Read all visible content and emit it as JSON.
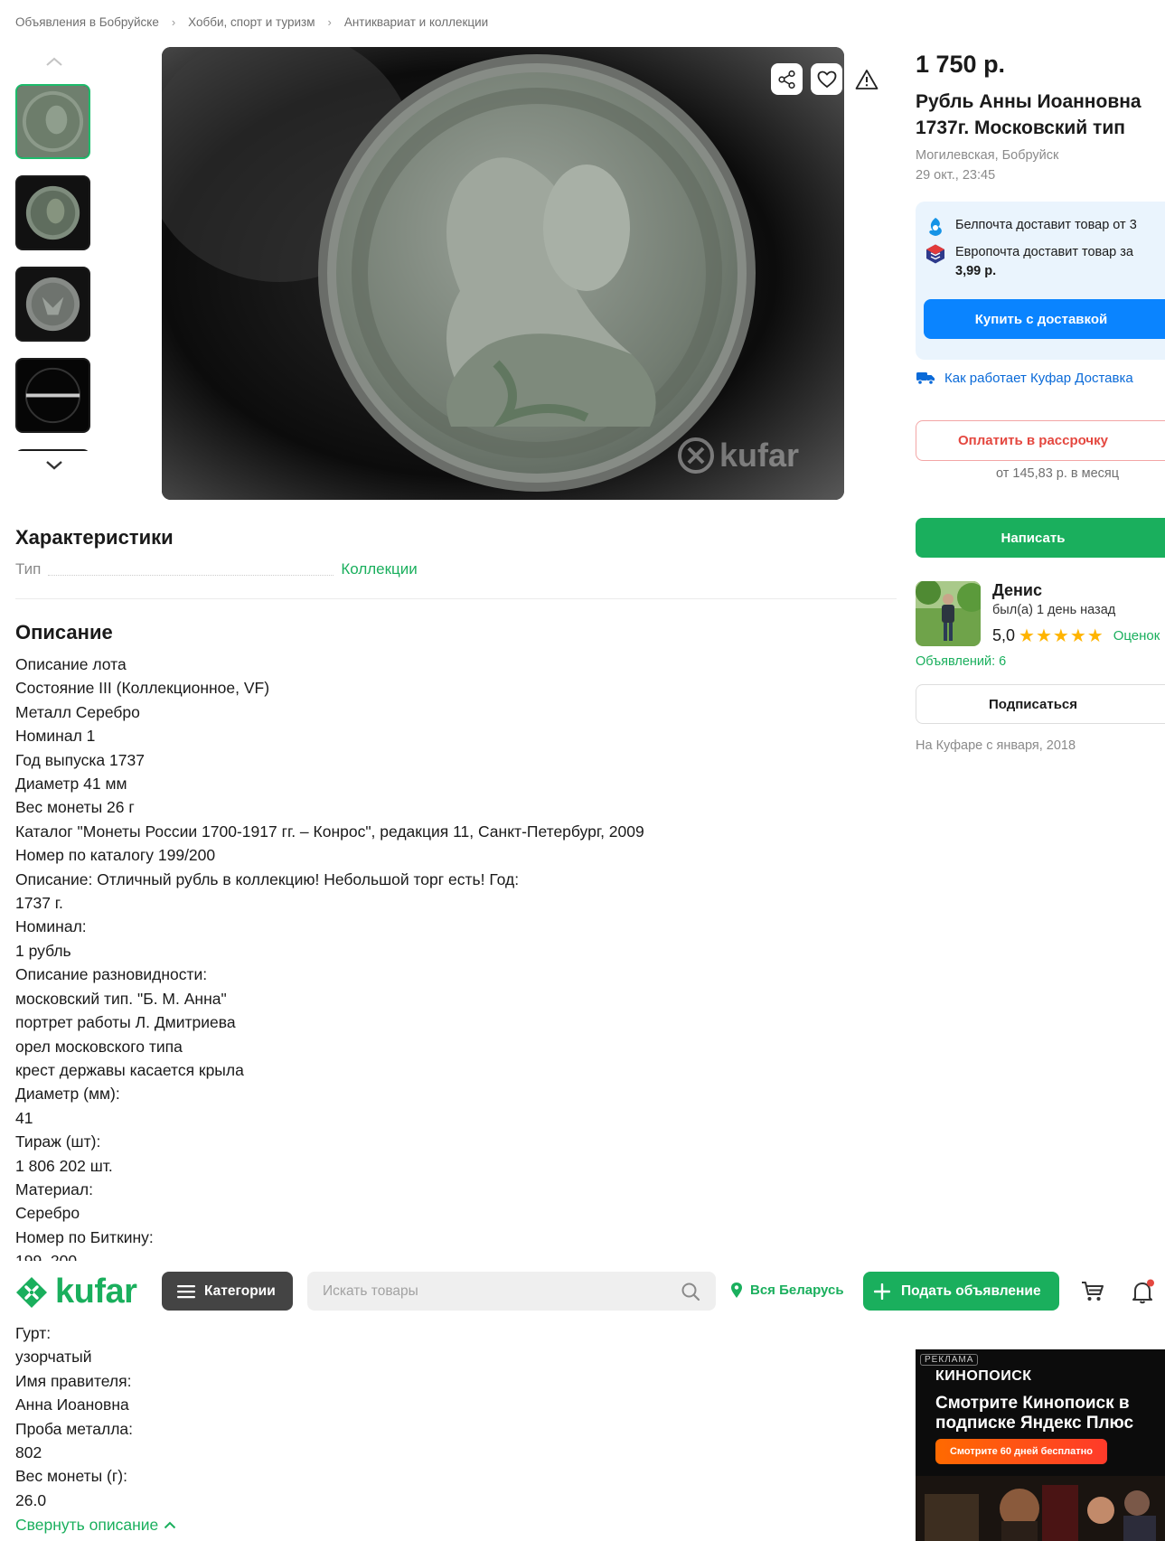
{
  "breadcrumb": [
    "Объявления в Бобруйске",
    "Хобби, спорт и туризм",
    "Антиквариат и коллекции"
  ],
  "breadcrumb_separator": "›",
  "gallery": {
    "thumb_count": 5,
    "active_index": 0,
    "watermark": "kufar",
    "actions": [
      "share-icon",
      "heart-icon",
      "warning-icon"
    ]
  },
  "listing": {
    "price": "1 750 р.",
    "title": "Рубль Анны Иоанновна 1737г. Московский тип",
    "location": "Могилевская, Бобруйск",
    "date": "29 окт., 23:45"
  },
  "delivery": {
    "belpochta": "Белпочта доставит товар от 3",
    "europochta_prefix": "Европочта доставит товар за",
    "europochta_price": "3,99 р.",
    "buy_button": "Купить с доставкой",
    "how_link": "Как работает Куфар Доставка"
  },
  "installment": {
    "button": "Оплатить в рассрочку",
    "per_month": "от 145,83 р. в месяц"
  },
  "write_button": "Написать",
  "seller": {
    "name": "Денис",
    "seen": "был(а) 1 день назад",
    "rating": "5,0",
    "stars": "★★★★★",
    "reviews_label": "Оценок",
    "ads_count": "Объявлений: 6",
    "subscribe": "Подписаться",
    "since": "На Куфаре с января, 2018"
  },
  "characteristics": {
    "heading": "Характеристики",
    "rows": [
      {
        "key": "Тип",
        "value": "Коллекции"
      }
    ]
  },
  "description": {
    "heading": "Описание",
    "lines": [
      "Описание лота",
      "Состояние III (Коллекционное, VF)",
      "Металл Серебро",
      "Номинал 1",
      "Год выпуска 1737",
      "Диаметр 41 мм",
      "Вес монеты 26 г",
      "Каталог \"Монеты России 1700-1917 гг. – Конрос\", редакция 11, Санкт-Петербург, 2009",
      "Номер по каталогу 199/200",
      "Описание: Отличный рубль в коллекцию! Небольшой торг есть! Год:",
      "1737 г.",
      "Номинал:",
      "1 рубль",
      "Описание разновидности:",
      "московский тип. \"Б. М. Анна\"",
      "портрет работы Л. Дмитриева",
      "орел московского типа",
      "крест державы касается крыла",
      "Диаметр (мм):",
      "41",
      "Тираж (шт):",
      "1 806 202 шт.",
      "Материал:",
      "Серебро",
      "Номер по Биткину:",
      "199, 200"
    ],
    "lines_after_header": [
      "Гурт:",
      "узорчатый",
      "Имя правителя:",
      "Анна Иоановна",
      "Проба металла:",
      "802",
      "Вес монеты (г):",
      "26.0"
    ],
    "collapse": "Свернуть описание"
  },
  "header": {
    "logo": "kufar",
    "categories": "Категории",
    "search_placeholder": "Искать товары",
    "region": "Вся Беларусь",
    "post_ad": "Подать объявление"
  },
  "ad": {
    "tag": "РЕКЛАМА",
    "brand": "КИНОПОИСК",
    "headline": "Смотрите Кинопоиск в подписке Яндекс Плюс",
    "button": "Смотрите 60 дней бесплатно"
  },
  "colors": {
    "green": "#1aaf5d",
    "blue": "#0a84ff",
    "red": "#e4473f",
    "delivery_bg": "#eaf4fd",
    "star": "#ffb400"
  }
}
